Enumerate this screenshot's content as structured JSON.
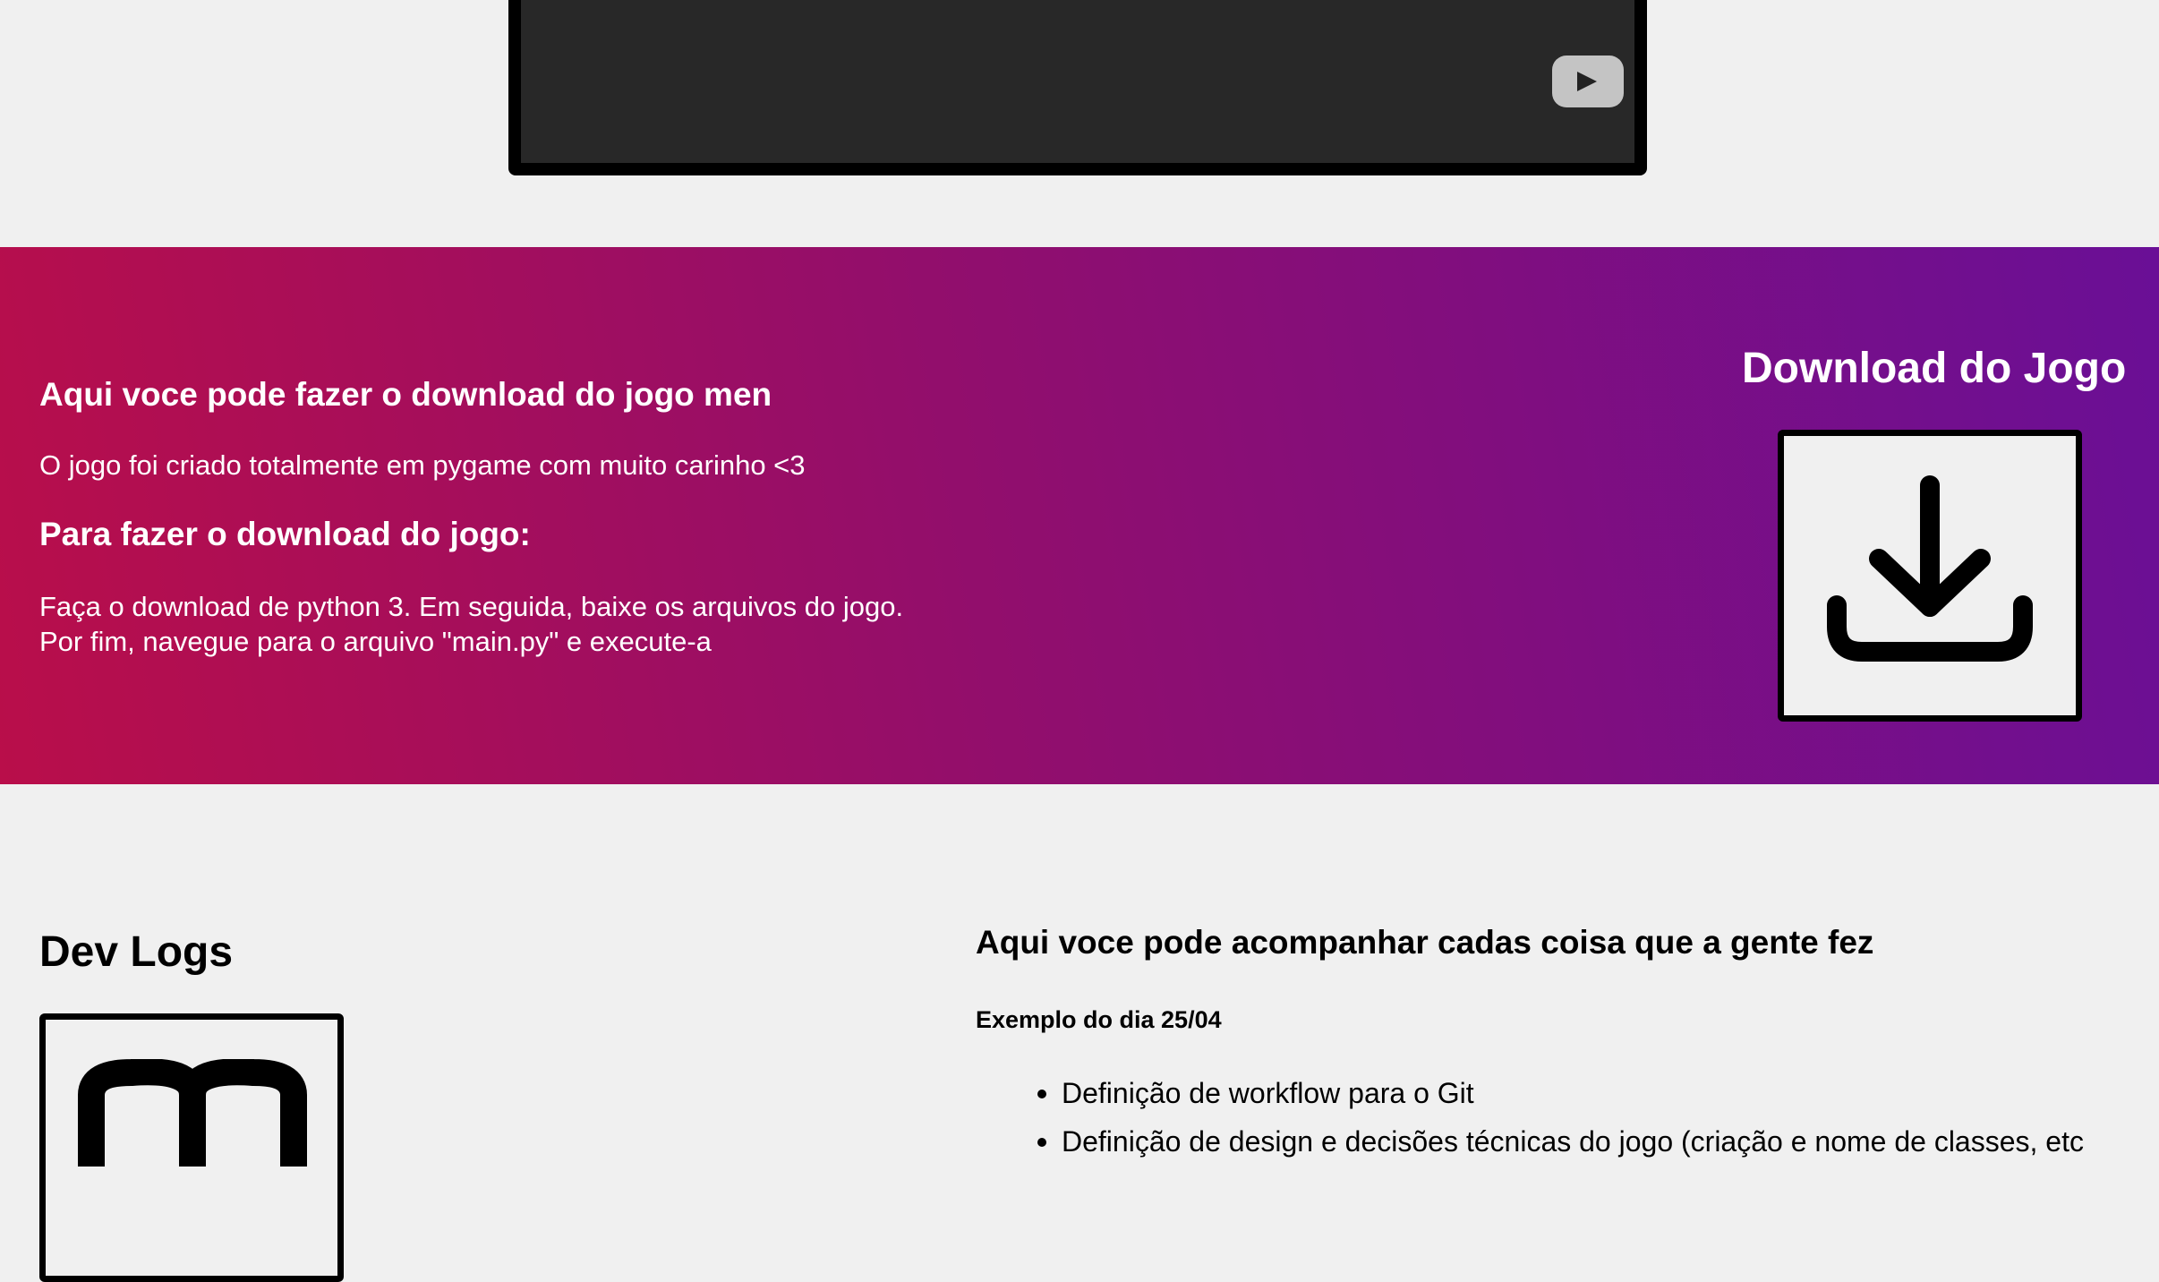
{
  "video": {
    "play_icon": "youtube-play-icon",
    "colors": {
      "player_background": "#282828",
      "frame_border": "#000000",
      "play_button": "#c4c4c4"
    }
  },
  "download_section": {
    "heading": "Aqui voce pode fazer o download do jogo men",
    "description": "O jogo foi criado totalmente em pygame com muito carinho <3",
    "subheading": "Para fazer o download do jogo:",
    "steps_line1": "Faça o download de python 3. Em seguida, baixe os arquivos do jogo.",
    "steps_line2": "Por fim, navegue para o arquivo \"main.py\" e execute-a",
    "right_title": "Download do Jogo",
    "icon": "download-icon",
    "colors": {
      "gradient_start": "#b90e4a",
      "gradient_mid": "#920e6c",
      "gradient_end": "#6a0f96",
      "text": "#ffffff"
    }
  },
  "devlogs": {
    "title": "Dev Logs",
    "icon": "book-icon",
    "heading": "Aqui voce pode acompanhar cadas coisa que a gente fez",
    "example_label": "Exemplo do dia 25/04",
    "items": [
      "Definição de workflow para o Git",
      "Definição de design e decisões técnicas do jogo (criação e nome de classes, etc"
    ]
  },
  "page": {
    "background": "#f0f0f0"
  }
}
